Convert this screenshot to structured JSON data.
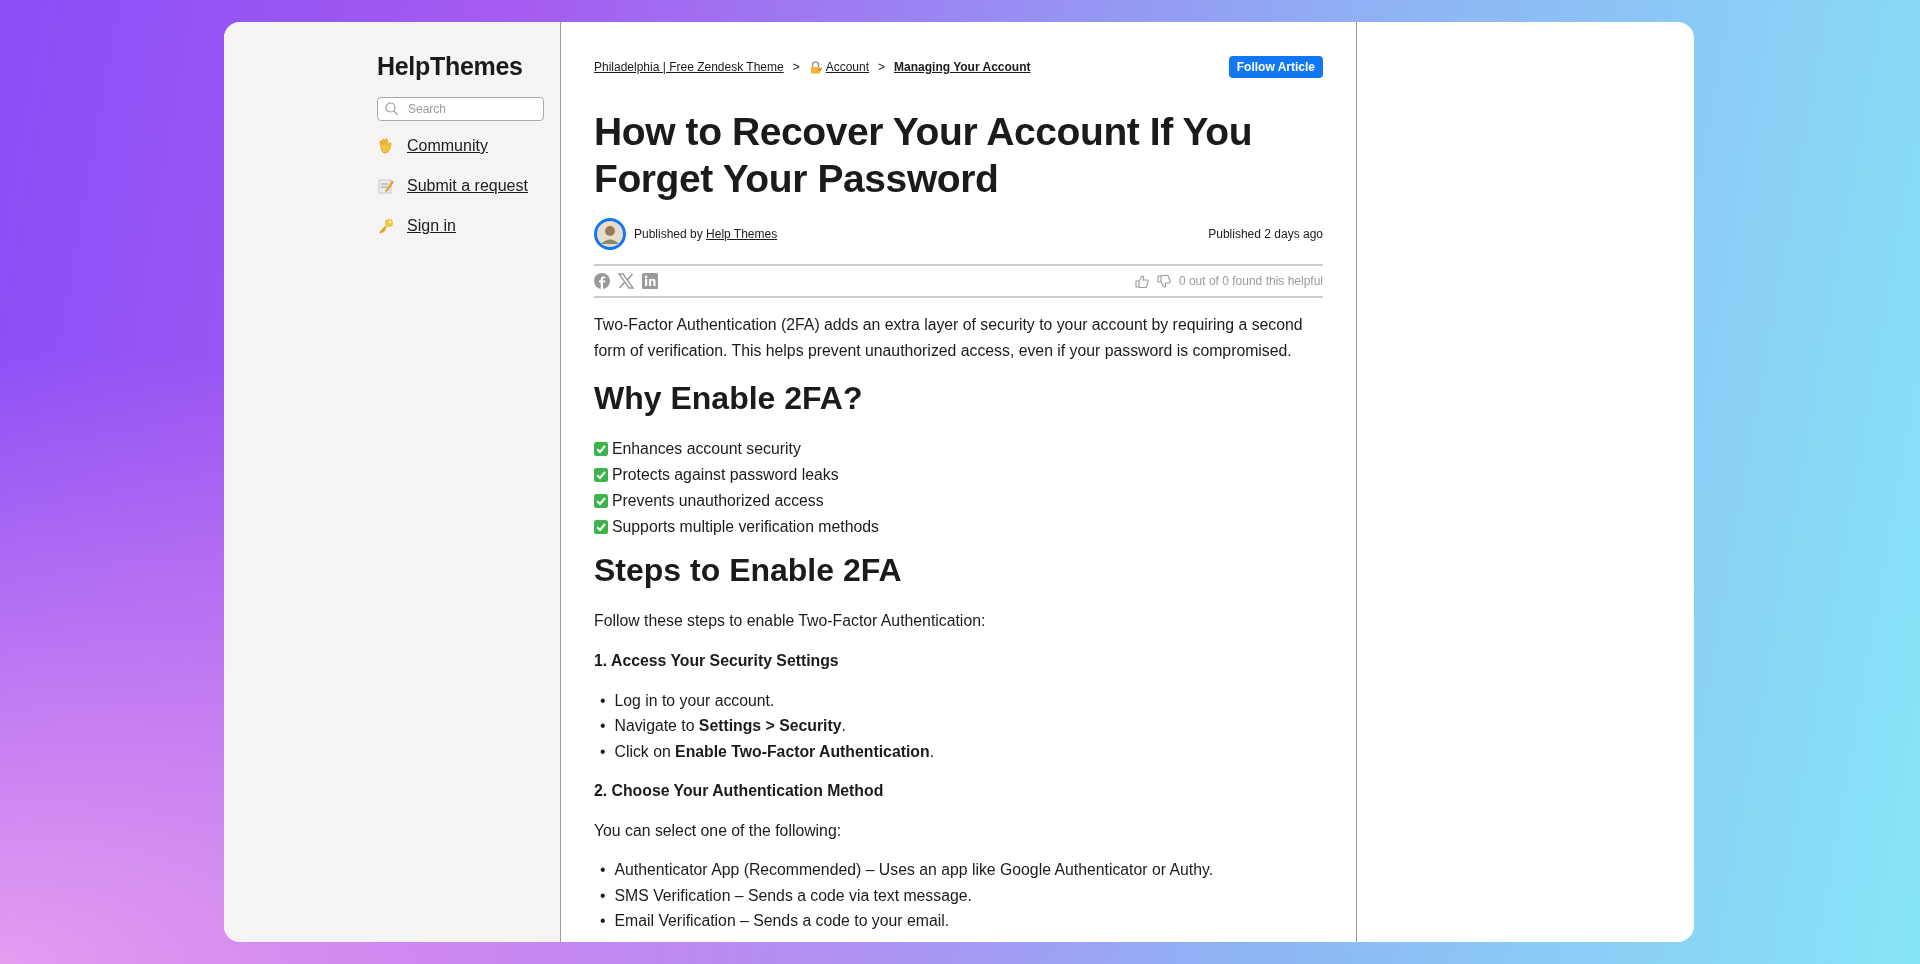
{
  "sidebar": {
    "logo": "HelpThemes",
    "search": {
      "placeholder": "Search"
    },
    "links": [
      {
        "label": "Community"
      },
      {
        "label": "Submit a request"
      },
      {
        "label": "Sign in"
      }
    ]
  },
  "breadcrumb": [
    {
      "label": "Philadelphia | Free Zendesk Theme",
      "current": false
    },
    {
      "label": "Account",
      "current": false
    },
    {
      "label": "Managing Your Account",
      "current": true
    }
  ],
  "breadcrumb_separators": [
    ">",
    ">"
  ],
  "follow_button": "Follow Article",
  "article": {
    "title": "How to Recover Your Account If You Forget Your Password",
    "author": {
      "prefix": "Published by",
      "name": "Help Themes"
    },
    "published": "Published 2 days ago",
    "helpful": "0 out of 0 found this helpful",
    "blocks": [
      {
        "kind": "paragraph",
        "text": "Two-Factor Authentication (2FA) adds an extra layer of security to your account by requiring a second form of verification. This helps prevent unauthorized access, even if your password is compromised."
      },
      {
        "kind": "heading",
        "text": "Why Enable 2FA?"
      },
      {
        "kind": "checklist",
        "items": [
          "Enhances account security",
          "Protects against password leaks",
          "Prevents unauthorized access",
          "Supports multiple verification methods"
        ]
      },
      {
        "kind": "heading",
        "text": "Steps to Enable 2FA"
      },
      {
        "kind": "paragraph",
        "text": "Follow these steps to enable Two-Factor Authentication:"
      },
      {
        "kind": "step",
        "text": "1. Access Your Security Settings"
      },
      {
        "kind": "bullets",
        "marker": "•",
        "items": [
          "Log in to your account.",
          "Navigate to **Settings > Security**.",
          "Click on **Enable Two-Factor Authentication**."
        ]
      },
      {
        "kind": "step",
        "text": "2. Choose Your Authentication Method"
      },
      {
        "kind": "paragraph",
        "text": "You can select one of the following:"
      },
      {
        "kind": "bullets",
        "marker": "•",
        "items": [
          "Authenticator App (Recommended) – Uses an app like Google Authenticator or Authy.",
          "SMS Verification – Sends a code via text message.",
          "Email Verification – Sends a code to your email."
        ]
      }
    ]
  }
}
